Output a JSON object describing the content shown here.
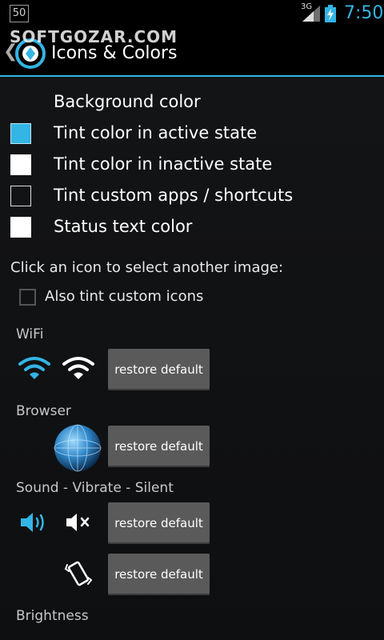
{
  "status_bar": {
    "notification_badge": "50",
    "network": "3G",
    "time": "7:50",
    "time_color": "#33b5e5"
  },
  "watermark": "SOFTGOZAR.COM",
  "action_bar": {
    "title": "Icons & Colors",
    "accent_color": "#33b5e5"
  },
  "color_options": [
    {
      "label": "Background color",
      "swatch": "none"
    },
    {
      "label": "Tint color in active state",
      "swatch": "#33b5e5"
    },
    {
      "label": "Tint color in inactive state",
      "swatch": "#ffffff"
    },
    {
      "label": "Tint custom apps / shortcuts",
      "swatch": "outline"
    },
    {
      "label": "Status text color",
      "swatch": "#ffffff"
    }
  ],
  "instructions": "Click an icon to select another image:",
  "also_tint_checkbox": {
    "label": "Also tint custom icons",
    "checked": false
  },
  "sections": {
    "wifi": {
      "label": "WiFi",
      "icons": [
        "wifi-active-icon",
        "wifi-inactive-icon"
      ],
      "button": "restore default"
    },
    "browser": {
      "label": "Browser",
      "icons": [
        "globe-icon"
      ],
      "button": "restore default"
    },
    "sound": {
      "label": "Sound - Vibrate - Silent",
      "icons": [
        "speaker-active-icon",
        "speaker-mute-icon",
        "vibrate-icon"
      ],
      "buttons": [
        "restore default",
        "restore default"
      ]
    },
    "brightness": {
      "label": "Brightness"
    }
  }
}
